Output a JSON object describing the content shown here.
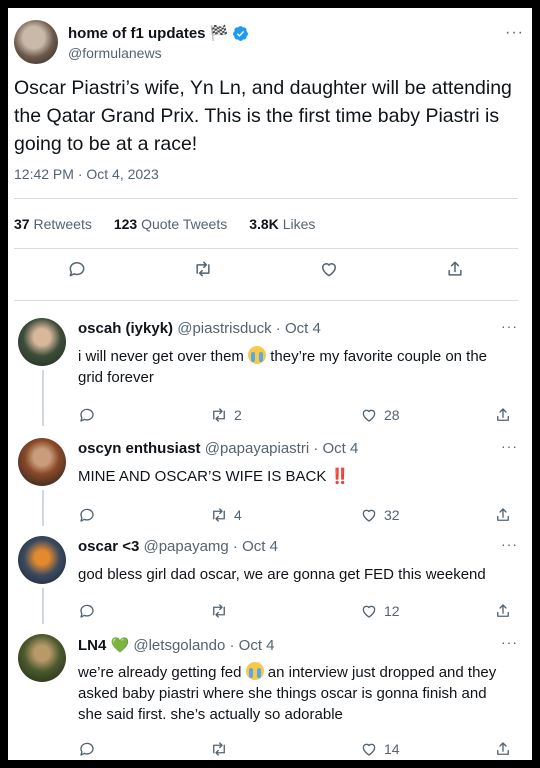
{
  "main_tweet": {
    "author_name": "home of f1 updates 🏁",
    "author_handle": "@formulanews",
    "text": "Oscar Piastri’s wife, Yn Ln, and daughter will be attending the Qatar Grand Prix. This is the first time baby Piastri is going to be at a race!",
    "timestamp": "12:42 PM · Oct 4, 2023",
    "more": "···",
    "stats": {
      "retweets_count": "37",
      "retweets_label": "Retweets",
      "quotes_count": "123",
      "quotes_label": "Quote Tweets",
      "likes_count": "3.8K",
      "likes_label": "Likes"
    }
  },
  "replies": [
    {
      "name": "oscah (iykyk)",
      "handle_date": "@piastrisduck · Oct 4",
      "text_before": "i will never get over them ",
      "emoji": "crying-face",
      "text_after": " they’re my favorite couple on the grid forever",
      "retweets": "2",
      "likes": "28"
    },
    {
      "name": "oscyn enthusiast",
      "handle_date": "@papayapiastri · Oct 4",
      "text_before": "MINE AND OSCAR’S WIFE IS BACK ",
      "text_after": "‼️",
      "retweets": "4",
      "likes": "32"
    },
    {
      "name": "oscar <3",
      "handle_date": "@papayamg · Oct 4",
      "text_before": "god bless girl dad oscar, we are gonna get FED this weekend",
      "text_after": "",
      "retweets": "",
      "likes": "12"
    },
    {
      "name": "LN4",
      "name_emoji": "💚",
      "handle_date": "@letsgolando · Oct 4",
      "text_before": "we’re already getting fed ",
      "emoji": "crying-face",
      "text_after": " an interview just dropped and they asked baby piastri where she things oscar is gonna finish and she said first. she’s actually so adorable",
      "retweets": "",
      "likes": "14"
    }
  ],
  "more": "···",
  "colors": {
    "text": "#0f1419",
    "muted": "#536471",
    "verified": "#1d9bf0",
    "divider": "#d7dde2"
  }
}
